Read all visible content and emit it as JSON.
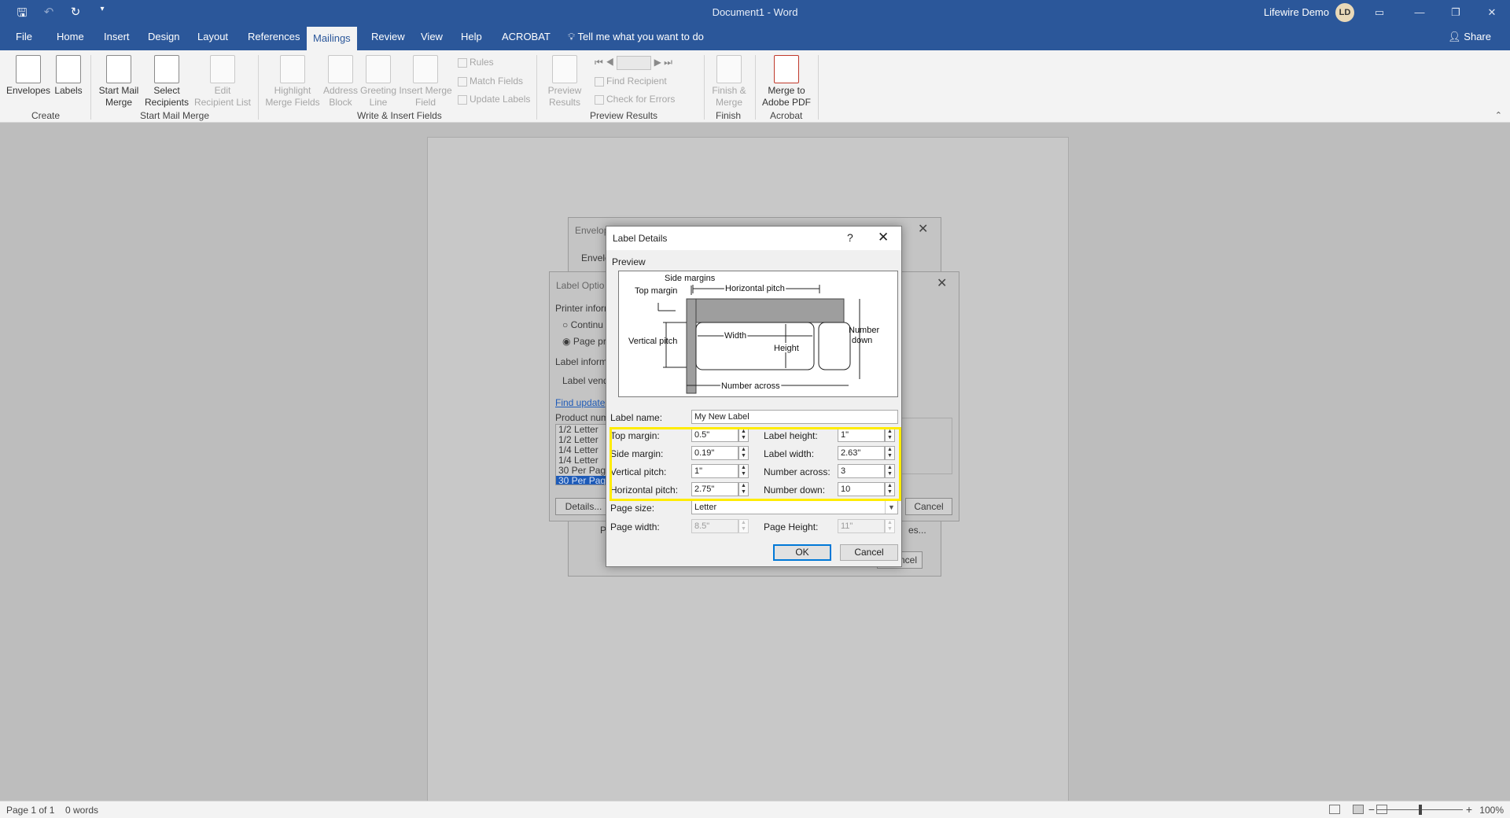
{
  "window": {
    "title": "Document1 - Word",
    "user": "Lifewire Demo",
    "avatar": "LD",
    "controls": [
      "ribbon-display-icon",
      "minimize-icon",
      "restore-icon",
      "close-icon"
    ]
  },
  "quick_access": [
    "save-icon",
    "undo-icon",
    "redo-icon",
    "customize-icon"
  ],
  "tabs": [
    "File",
    "Home",
    "Insert",
    "Design",
    "Layout",
    "References",
    "Mailings",
    "Review",
    "View",
    "Help",
    "ACROBAT"
  ],
  "active_tab": "Mailings",
  "tell_me": "Tell me what you want to do",
  "share": "Share",
  "ribbon": {
    "envelopes": "Envelopes",
    "labels": "Labels",
    "start_mail_merge_1": "Start Mail",
    "start_mail_merge_2": "Merge",
    "select_recipients_1": "Select",
    "select_recipients_2": "Recipients",
    "edit_recipient_1": "Edit",
    "edit_recipient_2": "Recipient List",
    "highlight_1": "Highlight",
    "highlight_2": "Merge Fields",
    "address_1": "Address",
    "address_2": "Block",
    "greeting_1": "Greeting",
    "greeting_2": "Line",
    "insert_merge_1": "Insert Merge",
    "insert_merge_2": "Field",
    "rules": "Rules",
    "match_fields": "Match Fields",
    "update_labels": "Update Labels",
    "preview_results_1": "Preview",
    "preview_results_2": "Results",
    "find_recipient": "Find Recipient",
    "check_errors": "Check for Errors",
    "finish_merge_1": "Finish &",
    "finish_merge_2": "Merge",
    "merge_pdf_1": "Merge to",
    "merge_pdf_2": "Adobe PDF",
    "groups": {
      "create": "Create",
      "start_mail_merge": "Start Mail Merge",
      "write_insert": "Write & Insert Fields",
      "preview_results": "Preview Results",
      "finish": "Finish",
      "acrobat": "Acrobat"
    }
  },
  "status": {
    "page": "Page 1 of 1",
    "words": "0 words",
    "zoom": "100%"
  },
  "bg_dialogs": {
    "envelopes_title": "Envelop",
    "envelopes_tab": "Envelo",
    "envelopes_cancel": "ncel",
    "label_options_title": "Label Optio",
    "printer_info": "Printer inform",
    "continuous": "Continu",
    "page_printers": "Page pr",
    "label_info": "Label inform",
    "label_vendors": "Label vend",
    "find_updates": "Find update",
    "product_number": "Product num",
    "products": [
      "1/2 Letter",
      "1/2 Letter",
      "1/4 Letter",
      "1/4 Letter",
      "30 Per Page",
      "30 Per Page"
    ],
    "details_button": "Details...",
    "cancel_button": "Cancel",
    "env_p": "P",
    "env_es": "es..."
  },
  "label_details": {
    "title": "Label Details",
    "help": "?",
    "preview_label": "Preview",
    "diagram": {
      "side_margins": "Side margins",
      "top_margin": "Top margin",
      "horizontal_pitch": "Horizontal pitch",
      "vertical_pitch": "Vertical pitch",
      "width": "Width",
      "height": "Height",
      "number_down_1": "Number",
      "number_down_2": "down",
      "number_across": "Number across"
    },
    "label_name_label": "Label name:",
    "label_name": "My New Label",
    "fields": {
      "top_margin_label": "Top margin:",
      "top_margin": "0.5\"",
      "side_margin_label": "Side margin:",
      "side_margin": "0.19\"",
      "vertical_pitch_label": "Vertical pitch:",
      "vertical_pitch": "1\"",
      "horizontal_pitch_label": "Horizontal pitch:",
      "horizontal_pitch": "2.75\"",
      "label_height_label": "Label height:",
      "label_height": "1\"",
      "label_width_label": "Label width:",
      "label_width": "2.63\"",
      "number_across_label": "Number across:",
      "number_across": "3",
      "number_down_label": "Number down:",
      "number_down": "10",
      "page_size_label": "Page size:",
      "page_size": "Letter",
      "page_width_label": "Page width:",
      "page_width": "8.5\"",
      "page_height_label": "Page Height:",
      "page_height": "11\""
    },
    "ok": "OK",
    "cancel": "Cancel"
  },
  "colors": {
    "title_bar": "#2b579a",
    "highlight": "#ffec00",
    "default_button_border": "#0078d7"
  }
}
